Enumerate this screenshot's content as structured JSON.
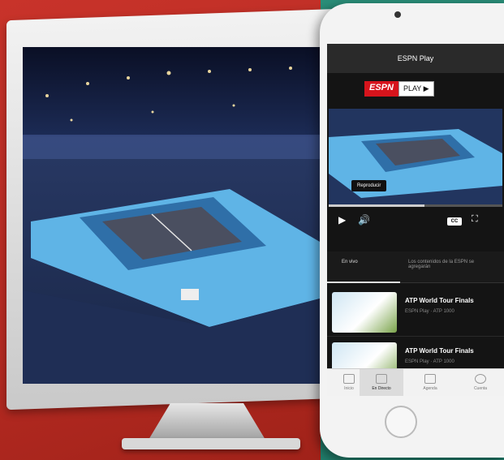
{
  "phone": {
    "header_title": "ESPN Play",
    "logo_espn": "ESPN",
    "logo_play": "PLAY ▶",
    "tooltip": "Reproducir",
    "progress": 0.55,
    "cc_label": "CC",
    "tabs": [
      "En vivo",
      "Los contenidos de la ESPN se agregarán"
    ],
    "items": [
      {
        "title": "ATP World Tour Finals",
        "subtitle": "ESPN Play · ATP 1000"
      },
      {
        "title": "ATP World Tour Finals",
        "subtitle": "ESPN Play · ATP 1000"
      }
    ],
    "nav": [
      "Inicio",
      "En Directo",
      "Agenda",
      "Cuenta"
    ]
  },
  "colors": {
    "espn_red": "#d6141c",
    "bg_red": "#c8332a",
    "bg_teal": "#2a8d78"
  }
}
